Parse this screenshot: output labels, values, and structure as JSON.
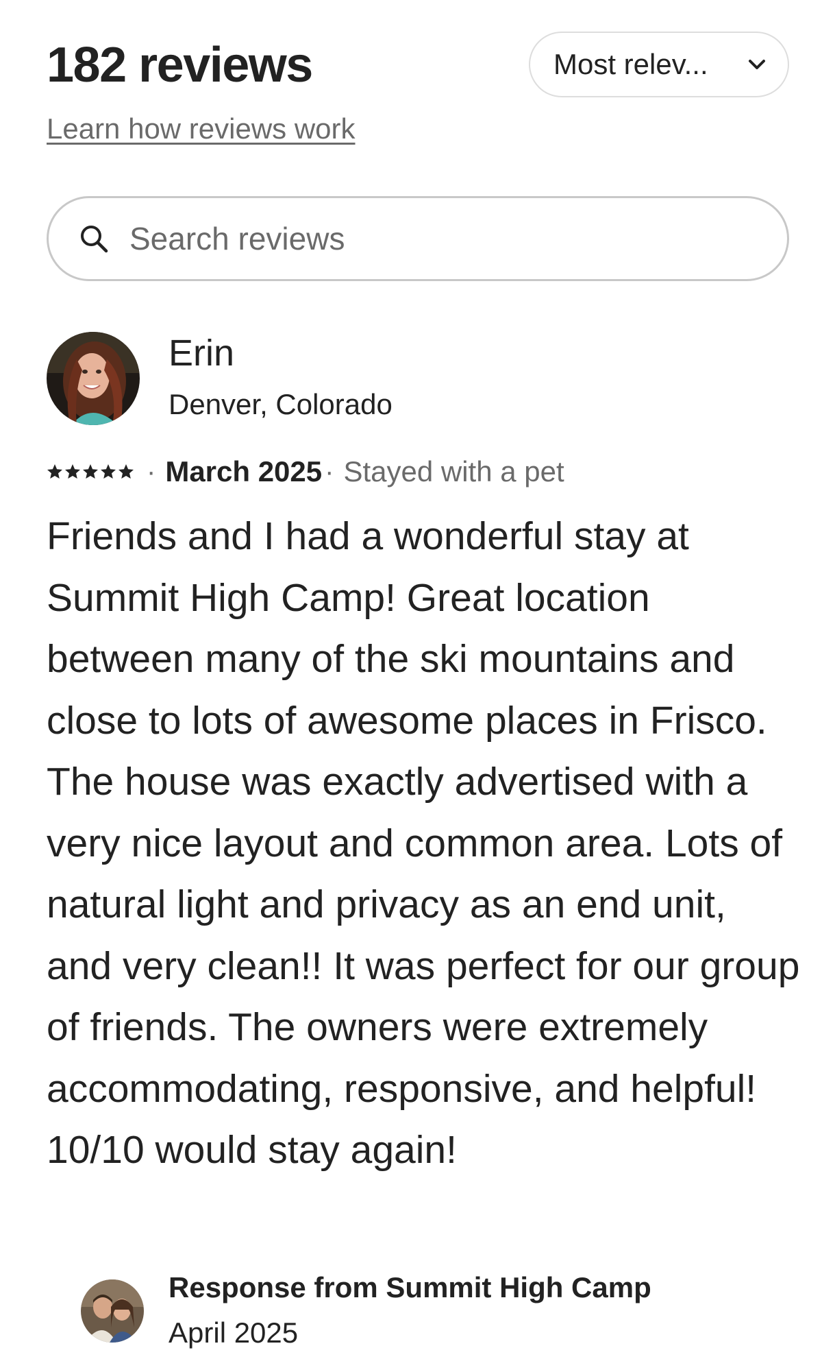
{
  "header": {
    "review_count_label": "182 reviews",
    "sort_label": "Most relev...",
    "learn_link": "Learn how reviews work"
  },
  "search": {
    "placeholder": "Search reviews",
    "value": ""
  },
  "review": {
    "reviewer_name": "Erin",
    "reviewer_location": "Denver, Colorado",
    "rating": 5,
    "separator": "·",
    "date": "March 2025",
    "stay_note": "Stayed with a pet",
    "body": "Friends and I had a wonderful stay at Summit High Camp! Great location between many of the ski mountains and close to lots of awesome places in Frisco. The house was exactly advertised with a very nice layout and common area. Lots of natural light and privacy as an end unit, and very clean!! It was perfect for our group of friends. The owners were extremely accommodating, responsive, and helpful! 10/10 would stay again!"
  },
  "response": {
    "title": "Response from Summit High Camp",
    "date": "April 2025"
  },
  "icons": {
    "search": "search-icon",
    "sort": "chevron-down-icon",
    "star": "star-icon"
  },
  "colors": {
    "text_primary": "#222222",
    "text_secondary": "#6a6a6a",
    "border": "#c8c8c8"
  }
}
